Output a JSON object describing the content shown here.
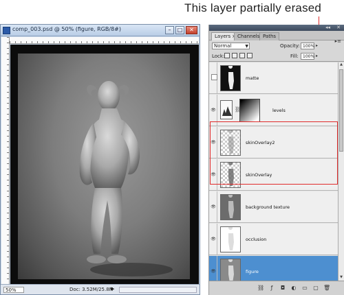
{
  "callout": {
    "text": "This layer partially erased",
    "color": "#e02a2a"
  },
  "document": {
    "title": "comp_003.psd @ 50% (figure, RGB/8#)",
    "status": {
      "zoom": "50%",
      "doc": "Doc: 3.52M/25.8M"
    }
  },
  "layers_panel": {
    "tabs": [
      {
        "label": "Layers",
        "close": "×",
        "active": true
      },
      {
        "label": "Channels"
      },
      {
        "label": "Paths"
      }
    ],
    "blend_mode": "Normal",
    "opacity_label": "Opacity:",
    "opacity_value": "100%",
    "lock_label": "Lock:",
    "fill_label": "Fill:",
    "fill_value": "100%",
    "layers": [
      {
        "name": "matte",
        "visible": false,
        "thumb": "dark-figure"
      },
      {
        "name": "levels",
        "visible": true,
        "thumb": "levels-adjustment"
      },
      {
        "name": "skinOverlay2",
        "visible": true,
        "thumb": "checker-figure"
      },
      {
        "name": "skinOverlay",
        "visible": true,
        "thumb": "checker-figure"
      },
      {
        "name": "background texture",
        "visible": true,
        "thumb": "gray-figure"
      },
      {
        "name": "occlusion",
        "visible": true,
        "thumb": "white-figure"
      },
      {
        "name": "figure",
        "visible": true,
        "selected": true,
        "thumb": "figure"
      }
    ],
    "bottom_icons": [
      "link-icon",
      "fx-icon",
      "mask-icon",
      "adjustment-icon",
      "folder-icon",
      "new-layer-icon",
      "trash-icon"
    ],
    "selected_color": "#4d8fd0"
  }
}
